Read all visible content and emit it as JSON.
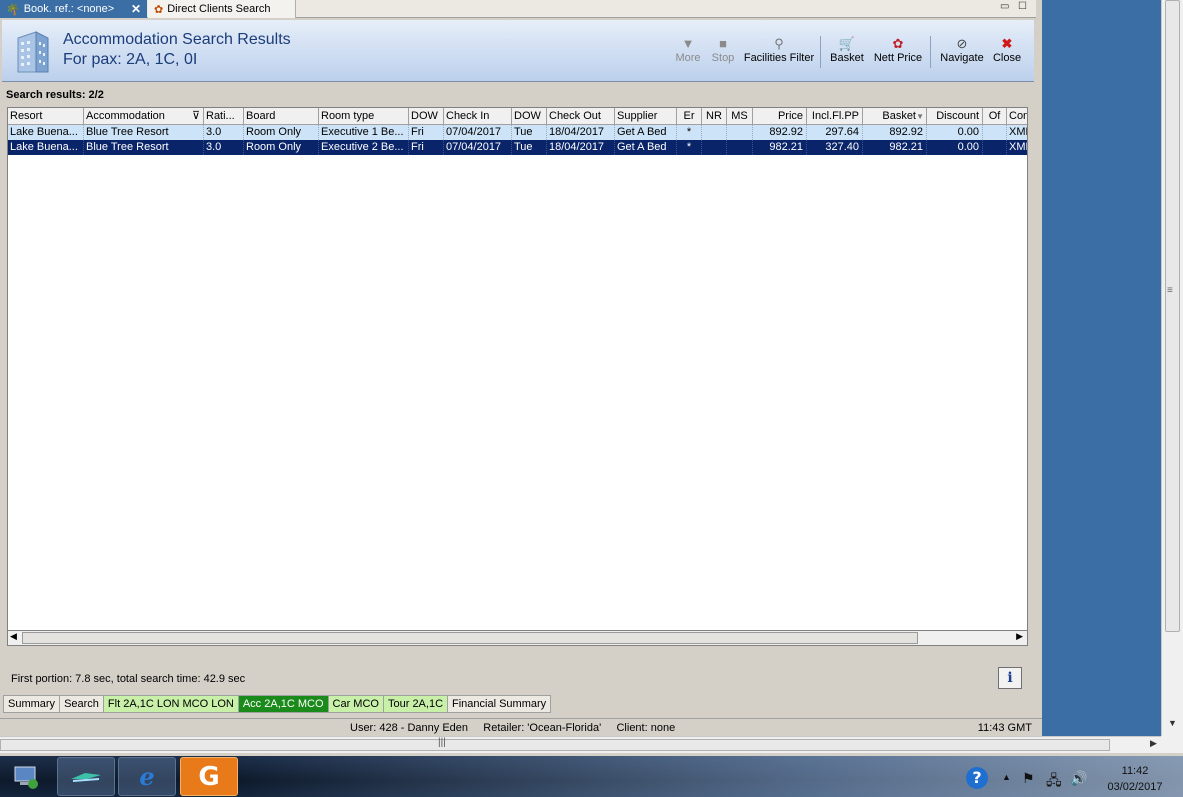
{
  "tabs": [
    {
      "label": "Book. ref.: <none>"
    },
    {
      "label": "Direct Clients Search"
    }
  ],
  "header": {
    "title": "Accommodation Search Results",
    "subtitle": "For pax: 2A, 1C, 0I"
  },
  "toolbar": {
    "more": "More",
    "stop": "Stop",
    "facilities_filter": "Facilities Filter",
    "basket": "Basket",
    "nett_price": "Nett Price",
    "navigate": "Navigate",
    "close": "Close"
  },
  "results_label": "Search results: 2/2",
  "grid": {
    "columns": [
      "Resort",
      "Accommodation",
      "Rati...",
      "Board",
      "Room type",
      "DOW",
      "Check In",
      "DOW",
      "Check Out",
      "Supplier",
      "Er",
      "NR",
      "MS",
      "Price",
      "Incl.Fl.PP",
      "Basket",
      "Discount",
      "Of",
      "Con"
    ],
    "rows": [
      [
        "Lake Buena...",
        "Blue Tree Resort",
        "3.0",
        "Room Only",
        "Executive 1 Be...",
        "Fri",
        "07/04/2017",
        "Tue",
        "18/04/2017",
        "Get A Bed",
        "*",
        "",
        "",
        "892.92",
        "297.64",
        "892.92",
        "0.00",
        "",
        "XML"
      ],
      [
        "Lake Buena...",
        "Blue Tree Resort",
        "3.0",
        "Room Only",
        "Executive 2 Be...",
        "Fri",
        "07/04/2017",
        "Tue",
        "18/04/2017",
        "Get A Bed",
        "*",
        "",
        "",
        "982.21",
        "327.40",
        "982.21",
        "0.00",
        "",
        "XML"
      ]
    ]
  },
  "status_time": "First portion: 7.8 sec, total search time: 42.9 sec",
  "info_label": "i",
  "bottom_tabs": [
    "Summary",
    "Search",
    "Flt 2A,1C LON MCO LON",
    "Acc 2A,1C MCO",
    "Car MCO",
    "Tour 2A,1C",
    "Financial Summary"
  ],
  "statusbar": {
    "user_info": "User: 428 - Danny Eden     Retailer: 'Ocean-Florida'     Client: none",
    "time": "11:43 GMT"
  },
  "taskbar": {
    "clock_time": "11:42",
    "clock_date": "03/02/2017"
  },
  "colors": {
    "accent": "#3a6ea5",
    "selected_row": "#0a246a",
    "highlight_row": "#cde3f7",
    "active_green_tab": "#1a8a1a",
    "green_tab": "#c8f0a8"
  }
}
